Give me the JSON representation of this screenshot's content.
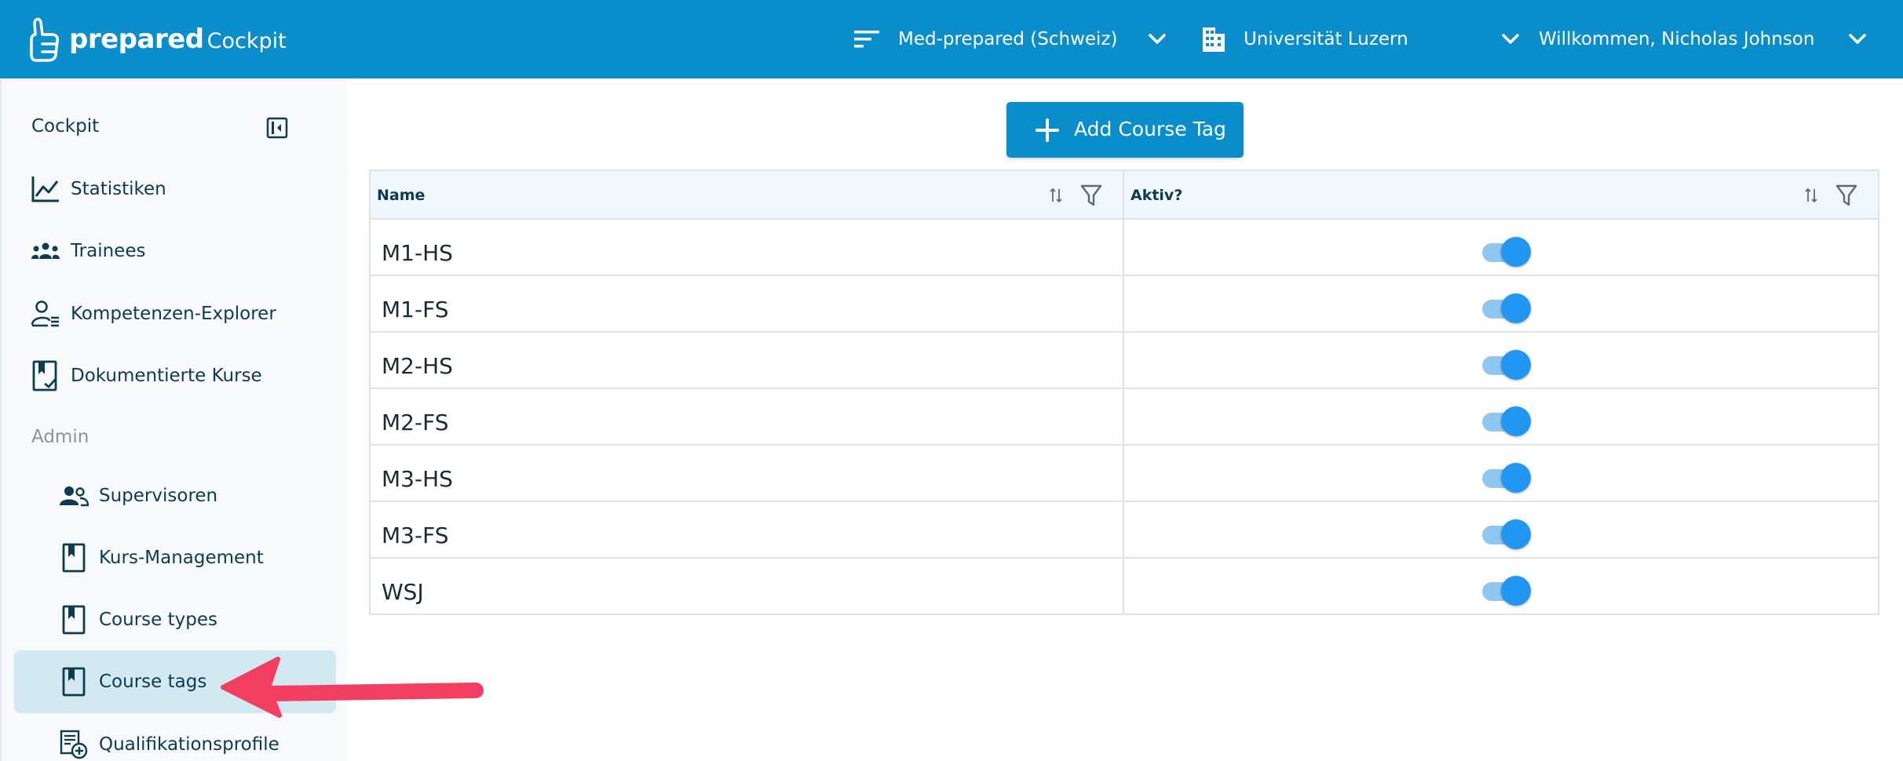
{
  "header": {
    "brand_name": "prepared",
    "brand_sub": "Cockpit",
    "org_selector": "Med-prepared (Schweiz)",
    "uni_selector": "Universität Luzern",
    "user_greeting": "Willkommen, Nicholas Johnson"
  },
  "sidebar": {
    "section_main": "Cockpit",
    "section_admin": "Admin",
    "items": [
      {
        "label": "Statistiken",
        "icon": "chart-line-icon"
      },
      {
        "label": "Trainees",
        "icon": "group-icon"
      },
      {
        "label": "Kompetenzen-Explorer",
        "icon": "person-list-icon"
      },
      {
        "label": "Dokumentierte Kurse",
        "icon": "bookmark-check-icon"
      }
    ],
    "admin_items": [
      {
        "label": "Supervisoren",
        "icon": "people-icon"
      },
      {
        "label": "Kurs-Management",
        "icon": "book-icon"
      },
      {
        "label": "Course types",
        "icon": "book-icon"
      },
      {
        "label": "Course tags",
        "icon": "book-icon",
        "active": true
      },
      {
        "label": "Qualifikationsprofile",
        "icon": "document-add-icon"
      }
    ]
  },
  "main": {
    "add_button": "Add Course Tag",
    "columns": [
      "Name",
      "Aktiv?"
    ],
    "rows": [
      {
        "name": "M1-HS",
        "active": true
      },
      {
        "name": "M1-FS",
        "active": true
      },
      {
        "name": "M2-HS",
        "active": true
      },
      {
        "name": "M2-FS",
        "active": true
      },
      {
        "name": "M3-HS",
        "active": true
      },
      {
        "name": "M3-FS",
        "active": true
      },
      {
        "name": "WSJ",
        "active": true
      }
    ]
  },
  "colors": {
    "brand": "#0a8ecb",
    "active_nav": "#d3e9f2",
    "toggle_on": "#2196f3",
    "annotation_arrow": "#f23e60"
  }
}
